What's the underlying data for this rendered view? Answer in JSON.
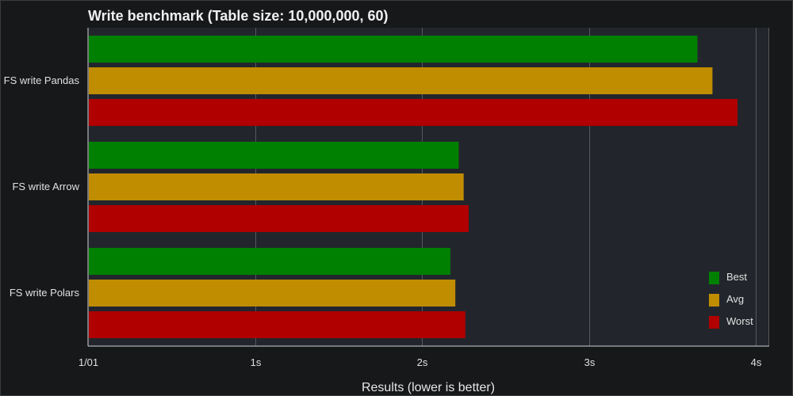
{
  "chart_data": {
    "type": "bar",
    "orientation": "horizontal",
    "title": "Write benchmark (Table size: 10,000,000, 60)",
    "xlabel": "Results (lower is better)",
    "ylabel": "",
    "categories": [
      "FS write Pandas",
      "FS write Arrow",
      "FS write Polars"
    ],
    "series": [
      {
        "name": "Best",
        "color": "#008000",
        "values": [
          3.65,
          2.22,
          2.17
        ]
      },
      {
        "name": "Avg",
        "color": "#c08c00",
        "values": [
          3.74,
          2.25,
          2.2
        ]
      },
      {
        "name": "Worst",
        "color": "#b00000",
        "values": [
          3.89,
          2.28,
          2.26
        ]
      }
    ],
    "xlim": [
      0,
      4.08
    ],
    "xticks": [
      {
        "value": 0,
        "label": "1/01"
      },
      {
        "value": 1,
        "label": "1s"
      },
      {
        "value": 2,
        "label": "2s"
      },
      {
        "value": 3,
        "label": "3s"
      },
      {
        "value": 4,
        "label": "4s"
      }
    ],
    "grid": true,
    "legend_position": "bottom-right"
  }
}
